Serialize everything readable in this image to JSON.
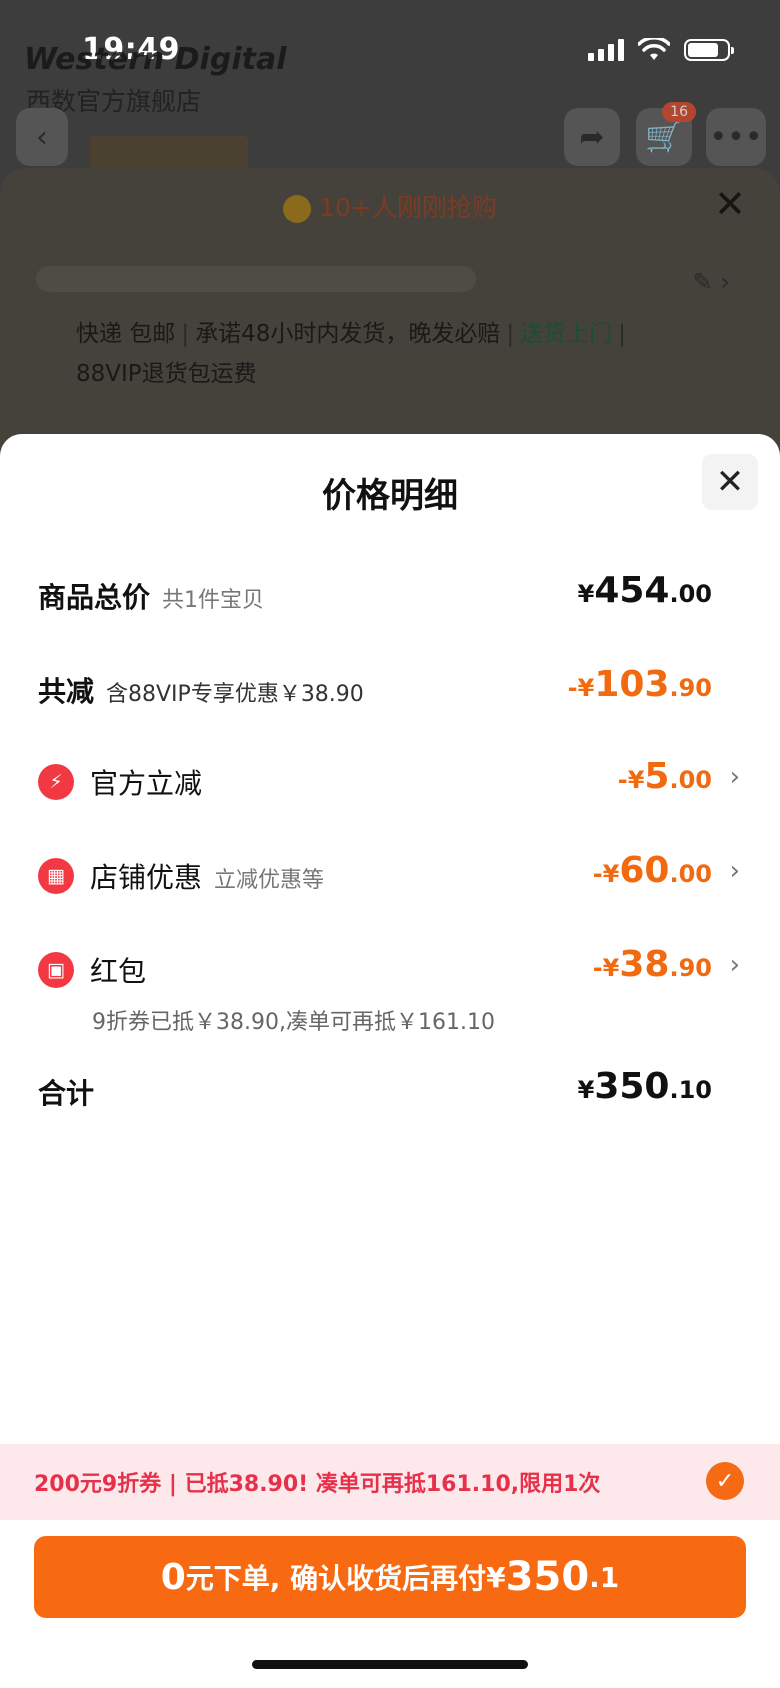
{
  "status_bar": {
    "time": "19:49"
  },
  "background": {
    "brand_logo": "Western Digital",
    "store_name": "西数官方旗舰店",
    "cart_badge": "16",
    "promo_text": "10+人刚刚抢购",
    "shipping_items": [
      "快递 包邮",
      "承诺48小时内发货，晚发必赔",
      "送货上门"
    ],
    "shipping_line2": "88VIP退货包运费"
  },
  "modal": {
    "title": "价格明细",
    "rows": {
      "total_goods": {
        "label": "商品总价",
        "sub": "共1件宝贝",
        "currency": "¥",
        "int": "454",
        "dec": ".00"
      },
      "total_discount": {
        "label": "共减",
        "sub": "含88VIP专享优惠￥38.90",
        "currency": "-¥",
        "int": "103",
        "dec": ".90"
      },
      "official": {
        "label": "官方立减",
        "currency": "-¥",
        "int": "5",
        "dec": ".00"
      },
      "store": {
        "label": "店铺优惠",
        "sub": "立减优惠等",
        "currency": "-¥",
        "int": "60",
        "dec": ".00"
      },
      "red_packet": {
        "label": "红包",
        "currency": "-¥",
        "int": "38",
        "dec": ".90",
        "note": "9折券已抵￥38.90,凑单可再抵￥161.10"
      },
      "sum": {
        "label": "合计",
        "currency": "¥",
        "int": "350",
        "dec": ".10"
      }
    }
  },
  "coupon_bar": {
    "text": "200元9折券 | 已抵38.90! 凑单可再抵161.10,限用1次"
  },
  "cta": {
    "part1": "0",
    "part2": "元下单, 确认收货后再付",
    "part3": "¥",
    "amount": "350",
    "dec": ".1"
  },
  "colors": {
    "accent": "#f86a12",
    "discount": "#f26a10",
    "coupon_bg": "#fde8ec",
    "coupon_text": "#e7314a",
    "icon_red": "#f23843"
  }
}
